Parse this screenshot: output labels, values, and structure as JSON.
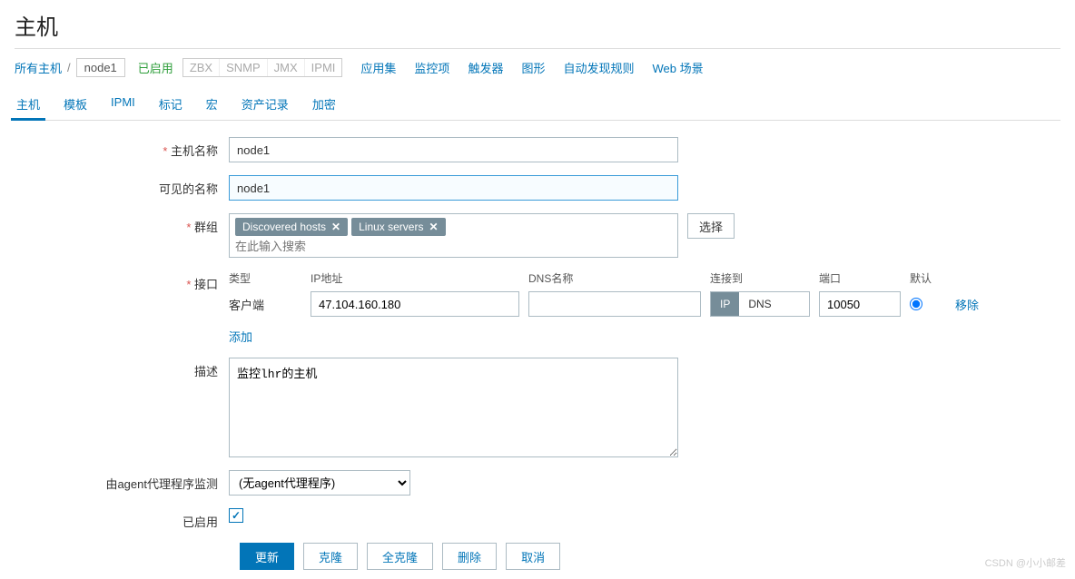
{
  "pageTitle": "主机",
  "breadcrumb": {
    "allHosts": "所有主机",
    "node": "node1"
  },
  "status": "已启用",
  "protocols": [
    "ZBX",
    "SNMP",
    "JMX",
    "IPMI"
  ],
  "navLinks": [
    "应用集",
    "监控项",
    "触发器",
    "图形",
    "自动发现规则",
    "Web 场景"
  ],
  "tabs": [
    "主机",
    "模板",
    "IPMI",
    "标记",
    "宏",
    "资产记录",
    "加密"
  ],
  "activeTab": 0,
  "labels": {
    "hostname": "主机名称",
    "visibleName": "可见的名称",
    "groups": "群组",
    "interfaces": "接口",
    "description": "描述",
    "proxy": "由agent代理程序监测",
    "enabled": "已启用",
    "selectBtn": "选择",
    "addLink": "添加",
    "removeLink": "移除"
  },
  "values": {
    "hostname": "node1",
    "visibleName": "node1",
    "groupTags": [
      "Discovered hosts",
      "Linux servers"
    ],
    "groupPlaceholder": "在此输入搜索",
    "description": "监控lhr的主机",
    "proxy": "(无agent代理程序)",
    "enabled": true
  },
  "iface": {
    "headers": {
      "type": "类型",
      "ip": "IP地址",
      "dns": "DNS名称",
      "connect": "连接到",
      "port": "端口",
      "default": "默认"
    },
    "row": {
      "type": "客户端",
      "ip": "47.104.160.180",
      "dns": "",
      "connectIP": "IP",
      "connectDNS": "DNS",
      "port": "10050"
    }
  },
  "buttons": {
    "update": "更新",
    "clone": "克隆",
    "fullClone": "全克隆",
    "delete": "删除",
    "cancel": "取消"
  },
  "watermark": "CSDN @小小邮差"
}
